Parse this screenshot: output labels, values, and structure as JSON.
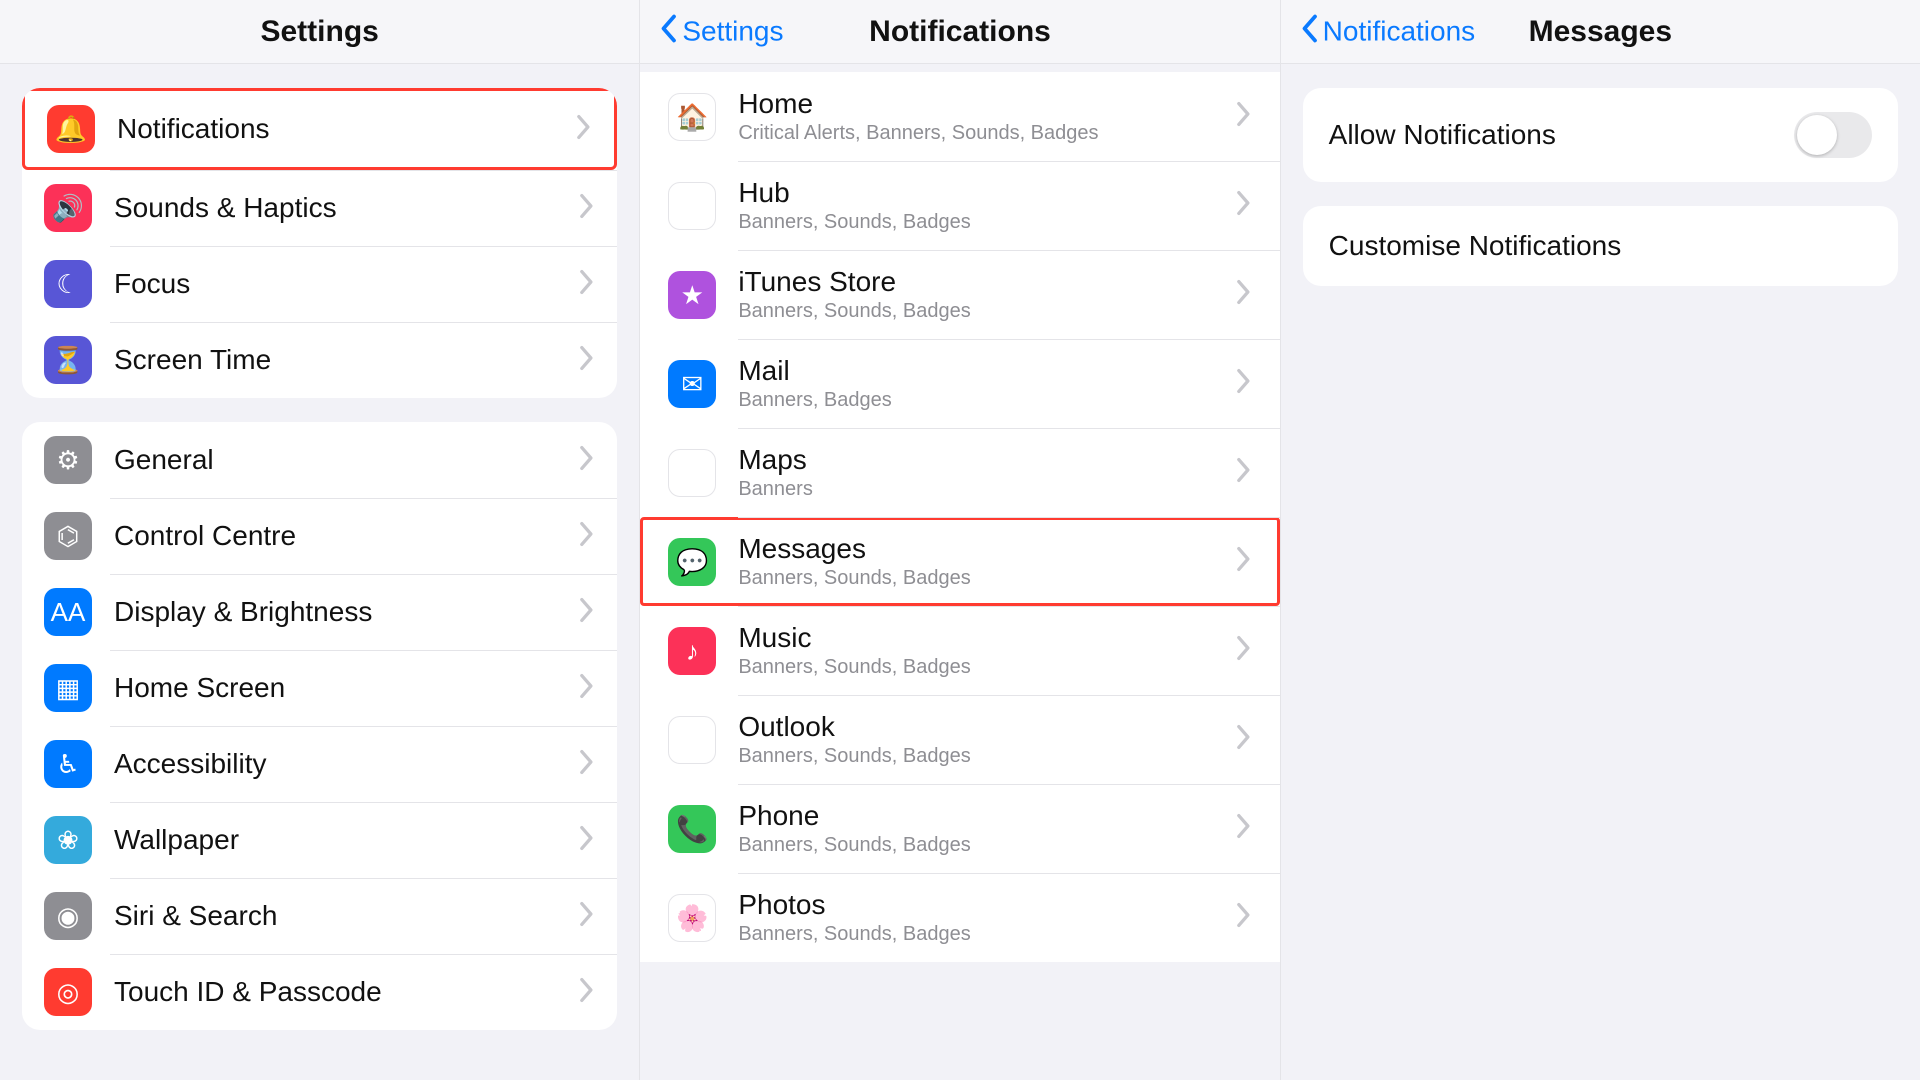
{
  "pane1": {
    "title": "Settings",
    "group1": [
      {
        "id": "notifications",
        "label": "Notifications",
        "iconColor": "bg-red",
        "icon": "bell-icon",
        "glyph": "🔔",
        "highlighted": true
      },
      {
        "id": "sounds",
        "label": "Sounds & Haptics",
        "iconColor": "bg-pink",
        "icon": "speaker-icon",
        "glyph": "🔊"
      },
      {
        "id": "focus",
        "label": "Focus",
        "iconColor": "bg-purple",
        "icon": "moon-icon",
        "glyph": "☾"
      },
      {
        "id": "screentime",
        "label": "Screen Time",
        "iconColor": "bg-purple",
        "icon": "hourglass-icon",
        "glyph": "⏳"
      }
    ],
    "group2": [
      {
        "id": "general",
        "label": "General",
        "iconColor": "bg-grey",
        "icon": "gear-icon",
        "glyph": "⚙︎"
      },
      {
        "id": "controlcentre",
        "label": "Control Centre",
        "iconColor": "bg-grey",
        "icon": "sliders-icon",
        "glyph": "⌬"
      },
      {
        "id": "display",
        "label": "Display & Brightness",
        "iconColor": "bg-blue",
        "icon": "aa-icon",
        "glyph": "AA"
      },
      {
        "id": "homescreen",
        "label": "Home Screen",
        "iconColor": "bg-blue",
        "icon": "grid-icon",
        "glyph": "▦"
      },
      {
        "id": "accessibility",
        "label": "Accessibility",
        "iconColor": "bg-blue",
        "icon": "person-icon",
        "glyph": "♿︎"
      },
      {
        "id": "wallpaper",
        "label": "Wallpaper",
        "iconColor": "bg-cyan",
        "icon": "flower-icon",
        "glyph": "❀"
      },
      {
        "id": "siri",
        "label": "Siri & Search",
        "iconColor": "bg-grey",
        "icon": "siri-icon",
        "glyph": "◉"
      },
      {
        "id": "touchid",
        "label": "Touch ID & Passcode",
        "iconColor": "bg-red",
        "icon": "fingerprint-icon",
        "glyph": "◎"
      }
    ]
  },
  "pane2": {
    "back": "Settings",
    "title": "Notifications",
    "apps": [
      {
        "id": "home",
        "label": "Home",
        "sub": "Critical Alerts, Banners, Sounds, Badges",
        "iconColor": "bg-white",
        "icon": "house-icon",
        "glyph": "🏠"
      },
      {
        "id": "hub",
        "label": "Hub",
        "sub": "Banners, Sounds, Badges",
        "iconColor": "bg-white",
        "icon": "cube-icon",
        "glyph": "◆"
      },
      {
        "id": "itunes",
        "label": "iTunes Store",
        "sub": "Banners, Sounds, Badges",
        "iconColor": "bg-lpurp",
        "icon": "star-icon",
        "glyph": "★"
      },
      {
        "id": "mail",
        "label": "Mail",
        "sub": "Banners, Badges",
        "iconColor": "bg-blue",
        "icon": "envelope-icon",
        "glyph": "✉︎"
      },
      {
        "id": "maps",
        "label": "Maps",
        "sub": "Banners",
        "iconColor": "bg-white",
        "icon": "map-icon",
        "glyph": "🗺"
      },
      {
        "id": "messages",
        "label": "Messages",
        "sub": "Banners, Sounds, Badges",
        "iconColor": "bg-green",
        "icon": "chat-icon",
        "glyph": "💬",
        "highlighted": true
      },
      {
        "id": "music",
        "label": "Music",
        "sub": "Banners, Sounds, Badges",
        "iconColor": "bg-pink",
        "icon": "music-icon",
        "glyph": "♪"
      },
      {
        "id": "outlook",
        "label": "Outlook",
        "sub": "Banners, Sounds, Badges",
        "iconColor": "bg-white",
        "icon": "outlook-icon",
        "glyph": "✉︎"
      },
      {
        "id": "phone",
        "label": "Phone",
        "sub": "Banners, Sounds, Badges",
        "iconColor": "bg-green",
        "icon": "phone-icon",
        "glyph": "📞"
      },
      {
        "id": "photos",
        "label": "Photos",
        "sub": "Banners, Sounds, Badges",
        "iconColor": "bg-white",
        "icon": "photos-icon",
        "glyph": "🌸"
      }
    ]
  },
  "pane3": {
    "back": "Notifications",
    "title": "Messages",
    "allow_label": "Allow Notifications",
    "allow_on": false,
    "customise_label": "Customise Notifications"
  }
}
